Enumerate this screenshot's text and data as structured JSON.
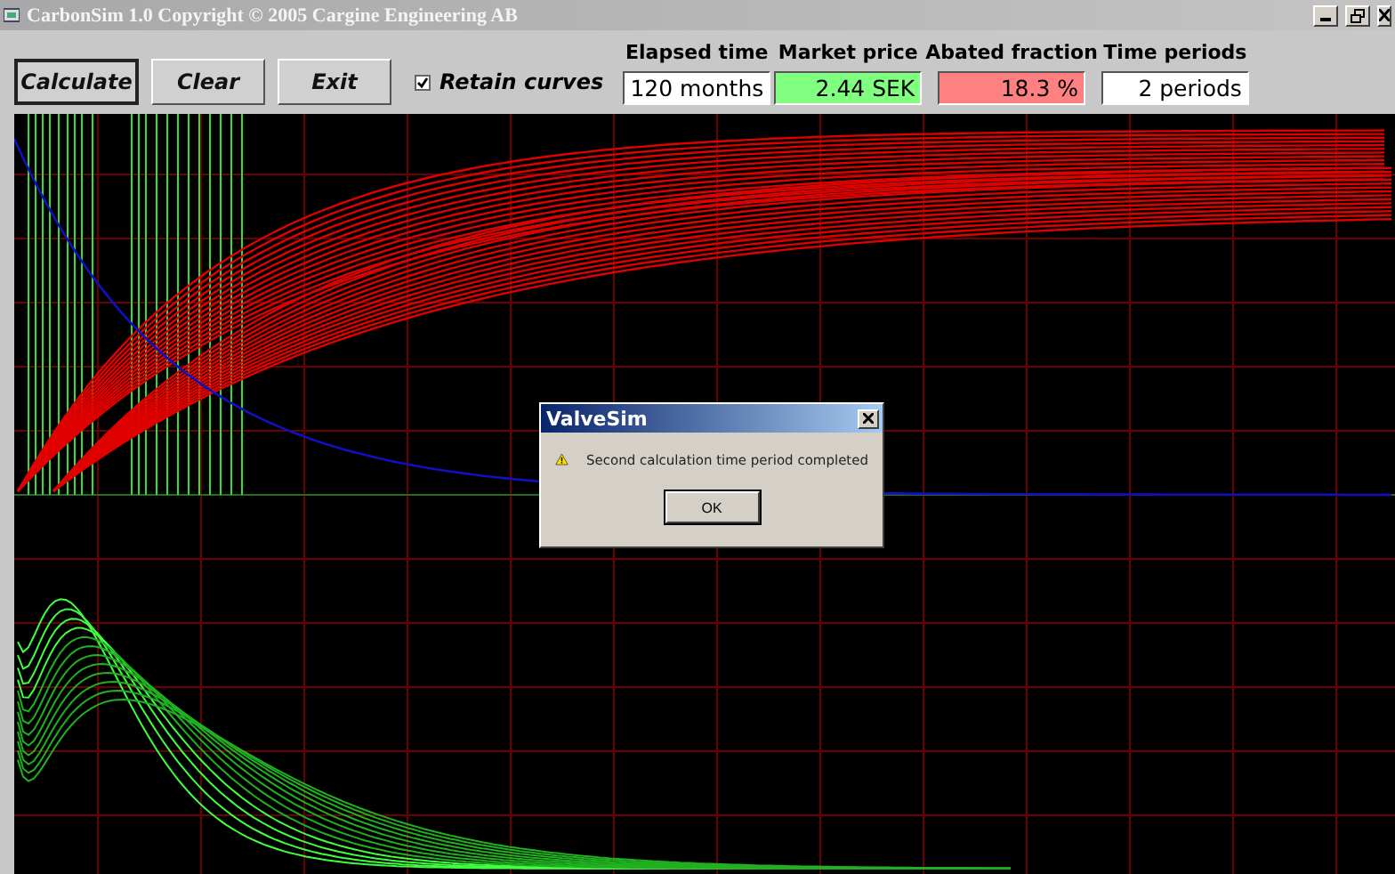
{
  "window": {
    "title": "CarbonSim 1.0  Copyright © 2005  Cargine Engineering AB"
  },
  "buttons": [
    {
      "label": "Calculate",
      "selected": true
    },
    {
      "label": "Clear",
      "selected": false
    },
    {
      "label": "Exit",
      "selected": false
    }
  ],
  "retain_curves": {
    "label": "Retain curves",
    "checked": true
  },
  "readouts": [
    {
      "label": "Elapsed time",
      "value": "120 months",
      "color": "#ffffff"
    },
    {
      "label": "Market price",
      "value": "2.44 SEK",
      "color": "#80ff80"
    },
    {
      "label": "Abated fraction",
      "value": "18.3 %",
      "color": "#ff8080"
    },
    {
      "label": "Time periods",
      "value": "2 periods",
      "color": "#ffffff"
    }
  ],
  "dialog": {
    "title": "ValveSim",
    "message": "Second calculation time period completed",
    "button": "OK"
  }
}
